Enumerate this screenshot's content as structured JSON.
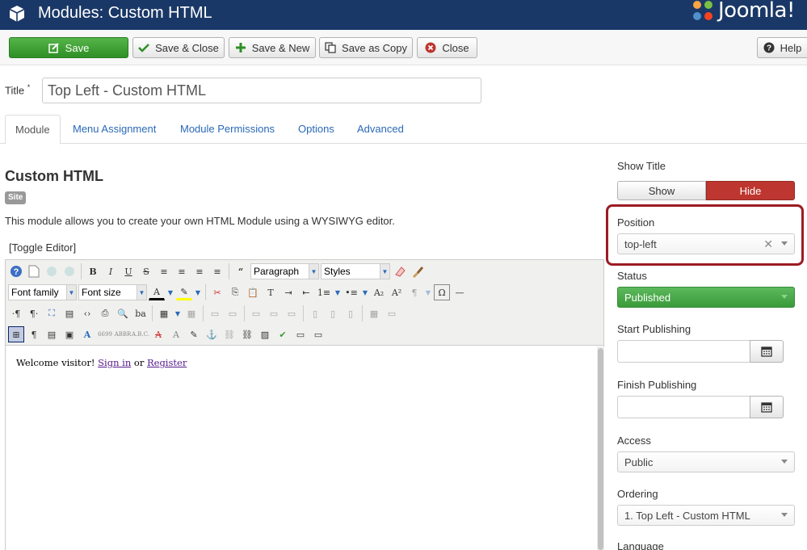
{
  "header": {
    "title": "Modules: Custom HTML",
    "brand": "Joomla!"
  },
  "toolbar": {
    "save": "Save",
    "save_close": "Save & Close",
    "save_new": "Save & New",
    "save_copy": "Save as Copy",
    "close": "Close",
    "help": "Help"
  },
  "form": {
    "title_label": "Title",
    "title_required": "*",
    "title_value": "Top Left - Custom HTML"
  },
  "tabs": [
    {
      "label": "Module",
      "active": true
    },
    {
      "label": "Menu Assignment"
    },
    {
      "label": "Module Permissions"
    },
    {
      "label": "Options"
    },
    {
      "label": "Advanced"
    }
  ],
  "module": {
    "heading": "Custom HTML",
    "badge": "Site",
    "description": "This module allows you to create your own HTML Module using a WYSIWYG editor.",
    "toggle_editor": "[Toggle Editor]"
  },
  "editor": {
    "format_select": "Paragraph",
    "styles_select": "Styles",
    "font_family": "Font family",
    "font_size": "Font size",
    "content_prefix": "Welcome visitor!",
    "sign_in": "Sign in",
    "or": "or",
    "register": "Register"
  },
  "sidebar": {
    "show_title_label": "Show Title",
    "show": "Show",
    "hide": "Hide",
    "position_label": "Position",
    "position_value": "top-left",
    "status_label": "Status",
    "status_value": "Published",
    "start_publishing_label": "Start Publishing",
    "finish_publishing_label": "Finish Publishing",
    "access_label": "Access",
    "access_value": "Public",
    "ordering_label": "Ordering",
    "ordering_value": "1. Top Left - Custom HTML",
    "language_label": "Language"
  },
  "colors": {
    "header_bg": "#1a3867",
    "save_green": "#2f8f26",
    "hide_red": "#bd362f",
    "published_green": "#3a9b3a",
    "highlight": "#9c1c24",
    "link": "#2a69b8"
  }
}
